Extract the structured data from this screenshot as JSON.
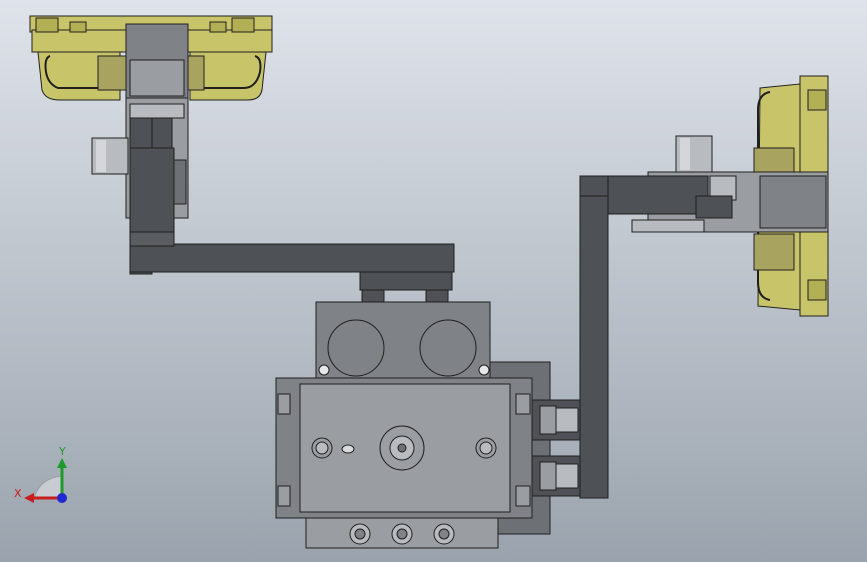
{
  "colors": {
    "background_top": "#dfe3ea",
    "background_bottom": "#9aa3ad",
    "cup_yellow": "#c8c46a",
    "cup_yellow_dark": "#8e8a3e",
    "bracket_dark": "#4e5156",
    "body_gray": "#7f8287",
    "body_gray_light": "#9a9da2",
    "outline": "#1f1f1f",
    "axis_x": "#c81e1e",
    "axis_y": "#1e9a2a",
    "axis_z": "#1e2ad0"
  },
  "triad": {
    "x_label": "X",
    "y_label": "Y"
  },
  "icons": {
    "triad": "view-orientation-triad-icon"
  }
}
